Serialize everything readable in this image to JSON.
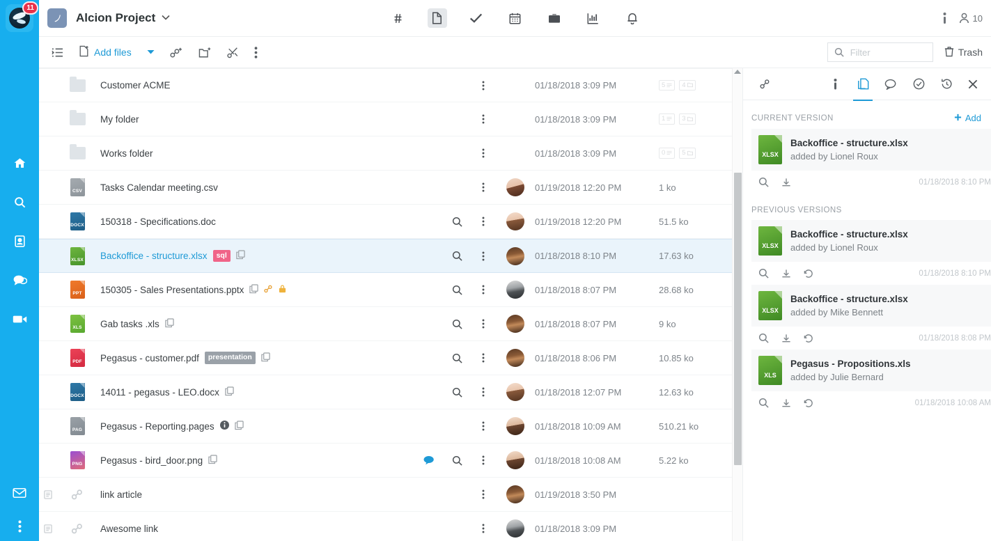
{
  "rail": {
    "badge": "11",
    "items": [
      {
        "icon": "home-icon",
        "name": "home"
      },
      {
        "icon": "search-icon",
        "name": "search"
      },
      {
        "icon": "contacts-icon",
        "name": "contacts"
      },
      {
        "icon": "chat-icon",
        "name": "chat"
      },
      {
        "icon": "video-icon",
        "name": "video"
      }
    ],
    "bottom": [
      {
        "icon": "mail-icon",
        "name": "mail"
      },
      {
        "icon": "more-vertical-icon",
        "name": "more"
      }
    ]
  },
  "header": {
    "project_title": "Alcion Project",
    "nav": [
      {
        "icon": "hash-icon",
        "name": "channels",
        "active": false
      },
      {
        "icon": "document-icon",
        "name": "documents",
        "active": true
      },
      {
        "icon": "check-icon",
        "name": "tasks",
        "active": false
      },
      {
        "icon": "calendar-icon",
        "name": "calendar",
        "active": false
      },
      {
        "icon": "briefcase-icon",
        "name": "briefcase",
        "active": false
      },
      {
        "icon": "chart-icon",
        "name": "reports",
        "active": false
      },
      {
        "icon": "bell-icon",
        "name": "notifications",
        "active": false
      }
    ],
    "info_icon": "info-icon",
    "members_icon": "person-icon",
    "members_count": "10"
  },
  "toolbar": {
    "view_toggle_icon": "list-view-icon",
    "add_files_label": "Add files",
    "add_files_icon": "file-plus-icon",
    "dropdown_caret": "▾",
    "add_link_icon": "link-plus-icon",
    "add_folder_icon": "folder-plus-icon",
    "cut_icon": "scissors-icon",
    "more_icon": "more-vertical-icon",
    "search_icon": "search-icon",
    "filter_placeholder": "Filter",
    "filter_value": "",
    "trash_label": "Trash",
    "trash_icon": "trash-icon"
  },
  "files": [
    {
      "type": "folder",
      "icon": "folder-icon",
      "name": "Customer ACME",
      "tag": "",
      "tag_class": "",
      "copy": false,
      "link": false,
      "lock": false,
      "info": false,
      "comment": false,
      "preview": false,
      "avatar": "",
      "date": "01/18/2018 3:09 PM",
      "size": "",
      "counts": [
        "5",
        "4"
      ],
      "selected": false
    },
    {
      "type": "folder",
      "icon": "folder-icon",
      "name": "My folder",
      "tag": "",
      "tag_class": "",
      "copy": false,
      "link": false,
      "lock": false,
      "info": false,
      "comment": false,
      "preview": false,
      "avatar": "",
      "date": "01/18/2018 3:09 PM",
      "size": "",
      "counts": [
        "1",
        "3"
      ],
      "selected": false
    },
    {
      "type": "folder",
      "icon": "folder-icon",
      "name": "Works folder",
      "tag": "",
      "tag_class": "",
      "copy": false,
      "link": false,
      "lock": false,
      "info": false,
      "comment": false,
      "preview": false,
      "avatar": "",
      "date": "01/18/2018 3:09 PM",
      "size": "",
      "counts": [
        "0",
        "5"
      ],
      "selected": false
    },
    {
      "type": "file",
      "icon": "csv-file-icon",
      "ext": "CSV",
      "fi": "fi-csv",
      "name": "Tasks Calendar meeting.csv",
      "tag": "",
      "tag_class": "",
      "copy": false,
      "link": false,
      "lock": false,
      "info": false,
      "comment": false,
      "preview": false,
      "avatar": "av-a",
      "date": "01/19/2018 12:20 PM",
      "size": "1 ko",
      "selected": false
    },
    {
      "type": "file",
      "icon": "docx-file-icon",
      "ext": "DOCX",
      "fi": "fi-docx",
      "name": "150318 - Specifications.doc",
      "tag": "",
      "tag_class": "",
      "copy": false,
      "link": false,
      "lock": false,
      "info": false,
      "comment": false,
      "preview": true,
      "avatar": "av-b",
      "date": "01/19/2018 12:20 PM",
      "size": "51.5 ko",
      "selected": false
    },
    {
      "type": "file",
      "icon": "xlsx-file-icon",
      "ext": "XLSX",
      "fi": "fi-xlsx",
      "name": "Backoffice - structure.xlsx",
      "tag": "sql",
      "tag_class": "sql",
      "copy": true,
      "link": false,
      "lock": false,
      "info": false,
      "comment": false,
      "preview": true,
      "avatar": "av-c",
      "date": "01/18/2018 8:10 PM",
      "size": "17.63 ko",
      "selected": true
    },
    {
      "type": "file",
      "icon": "ppt-file-icon",
      "ext": "PPT",
      "fi": "fi-ppt",
      "name": "150305 - Sales Presentations.pptx",
      "tag": "",
      "tag_class": "",
      "copy": true,
      "link": true,
      "lock": true,
      "info": false,
      "comment": false,
      "preview": true,
      "avatar": "av-d",
      "date": "01/18/2018 8:07 PM",
      "size": "28.68 ko",
      "selected": false
    },
    {
      "type": "file",
      "icon": "xls-file-icon",
      "ext": "XLS",
      "fi": "fi-xls",
      "name": "Gab tasks .xls",
      "tag": "",
      "tag_class": "",
      "copy": true,
      "link": false,
      "lock": false,
      "info": false,
      "comment": false,
      "preview": true,
      "avatar": "av-c",
      "date": "01/18/2018 8:07 PM",
      "size": "9 ko",
      "selected": false
    },
    {
      "type": "file",
      "icon": "pdf-file-icon",
      "ext": "PDF",
      "fi": "fi-pdf",
      "name": "Pegasus - customer.pdf",
      "tag": "presentation",
      "tag_class": "presentation",
      "copy": true,
      "link": false,
      "lock": false,
      "info": false,
      "comment": false,
      "preview": true,
      "avatar": "av-c",
      "date": "01/18/2018 8:06 PM",
      "size": "10.85 ko",
      "selected": false
    },
    {
      "type": "file",
      "icon": "docx-file-icon",
      "ext": "DOCX",
      "fi": "fi-docx",
      "name": "14011 - pegasus - LEO.docx",
      "tag": "",
      "tag_class": "",
      "copy": true,
      "link": false,
      "lock": false,
      "info": false,
      "comment": false,
      "preview": true,
      "avatar": "av-b",
      "date": "01/18/2018 12:07 PM",
      "size": "12.63 ko",
      "selected": false
    },
    {
      "type": "file",
      "icon": "pages-file-icon",
      "ext": "PAG",
      "fi": "fi-pages",
      "name": "Pegasus - Reporting.pages",
      "tag": "",
      "tag_class": "",
      "copy": true,
      "link": false,
      "lock": false,
      "info": true,
      "comment": false,
      "preview": false,
      "avatar": "av-e",
      "date": "01/18/2018 10:09 AM",
      "size": "510.21 ko",
      "selected": false
    },
    {
      "type": "file",
      "icon": "png-file-icon",
      "ext": "PNG",
      "fi": "fi-png",
      "name": "Pegasus - bird_door.png",
      "tag": "",
      "tag_class": "",
      "copy": true,
      "link": false,
      "lock": false,
      "info": false,
      "comment": true,
      "preview": true,
      "avatar": "av-e",
      "date": "01/18/2018 10:08 AM",
      "size": "5.22 ko",
      "selected": false
    },
    {
      "type": "link",
      "icon": "link-icon",
      "name": "link article",
      "tag": "",
      "tag_class": "",
      "copy": false,
      "link": false,
      "lock": false,
      "info": false,
      "comment": false,
      "preview": false,
      "avatar": "av-c",
      "date": "01/19/2018 3:50 PM",
      "size": "",
      "selected": false
    },
    {
      "type": "link",
      "icon": "link-icon",
      "name": "Awesome link",
      "tag": "",
      "tag_class": "",
      "copy": false,
      "link": false,
      "lock": false,
      "info": false,
      "comment": false,
      "preview": false,
      "avatar": "av-d",
      "date": "01/18/2018 3:09 PM",
      "size": "",
      "selected": false
    }
  ],
  "panel": {
    "tabs": [
      {
        "icon": "link-icon",
        "name": "links",
        "active": false
      },
      {
        "icon": "info-icon",
        "name": "info",
        "active": false
      },
      {
        "icon": "versions-icon",
        "name": "versions",
        "active": true
      },
      {
        "icon": "comments-icon",
        "name": "comments",
        "active": false
      },
      {
        "icon": "approval-icon",
        "name": "approvals",
        "active": false
      },
      {
        "icon": "history-icon",
        "name": "history",
        "active": false
      }
    ],
    "close_icon": "close-icon",
    "current_section_title": "CURRENT VERSION",
    "add_label": "Add",
    "add_icon": "plus-icon",
    "previous_section_title": "PREVIOUS VERSIONS",
    "current_version": {
      "ext": "XLSX",
      "name": "Backoffice - structure.xlsx",
      "author": "added by Lionel Roux",
      "timestamp": "01/18/2018 8:10 PM",
      "actions": [
        "preview-icon",
        "download-icon"
      ]
    },
    "previous_versions": [
      {
        "ext": "XLSX",
        "name": "Backoffice - structure.xlsx",
        "author": "added by Lionel Roux",
        "timestamp": "01/18/2018 8:10 PM",
        "actions": [
          "preview-icon",
          "download-icon",
          "restore-icon"
        ]
      },
      {
        "ext": "XLSX",
        "name": "Backoffice - structure.xlsx",
        "author": "added by Mike Bennett",
        "timestamp": "01/18/2018 8:08 PM",
        "actions": [
          "preview-icon",
          "download-icon",
          "restore-icon"
        ]
      },
      {
        "ext": "XLS",
        "name": "Pegasus - Propositions.xls",
        "author": "added by Julie Bernard",
        "timestamp": "01/18/2018 10:08 AM",
        "actions": [
          "preview-icon",
          "download-icon",
          "restore-icon"
        ]
      }
    ]
  },
  "colors": {
    "brand_blue": "#17aeee",
    "accent_link": "#1e9ad6",
    "selected_row": "#eaf4fb",
    "badge_red": "#e8324a",
    "tag_sql": "#f06488",
    "tag_presentation": "#9aa1a8"
  }
}
